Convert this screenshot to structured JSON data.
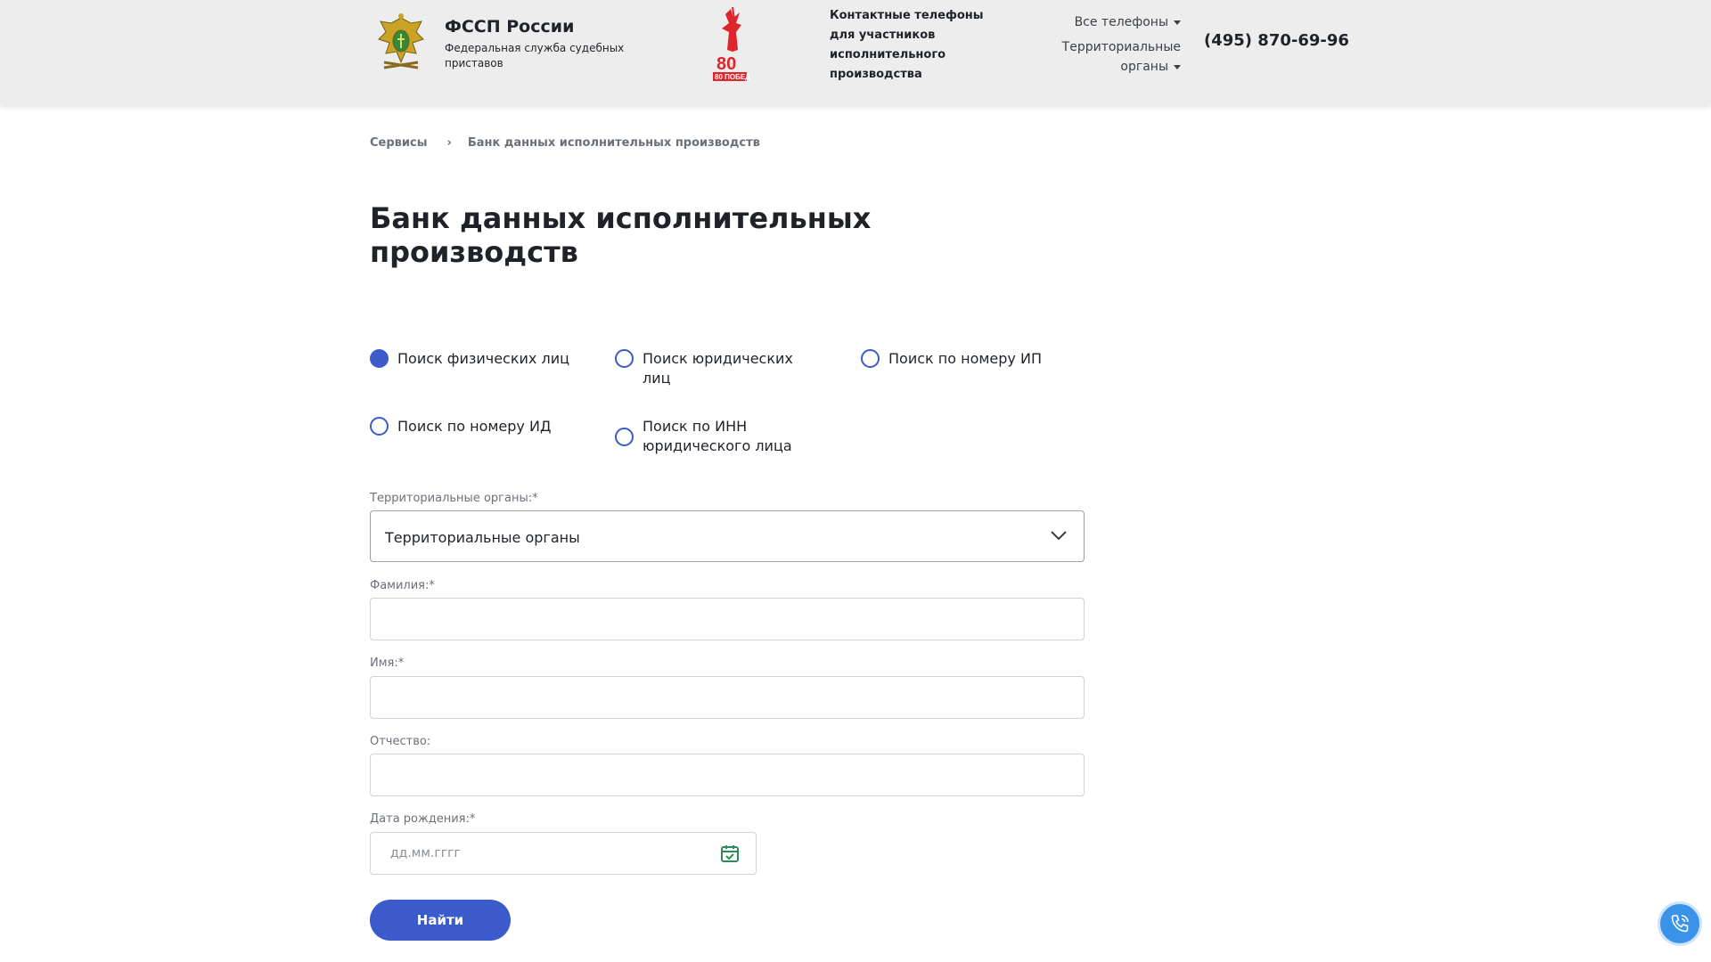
{
  "header": {
    "brand_title": "ФССП России",
    "brand_subtitle": "Федеральная служба судебных приставов",
    "victory_badge": "80 ПОБЕДА!",
    "contacts_text": "Контактные телефоны для участников исполнительного производства",
    "all_phones": "Все телефоны",
    "territorial": "Территориальные органы",
    "phone": "(495) 870-69-96"
  },
  "breadcrumb": {
    "items": [
      "Сервисы",
      "Банк данных исполнительных производств"
    ],
    "separator": "›"
  },
  "page_title": "Банк данных исполнительных производств",
  "search_types": [
    {
      "label": "Поиск физических лиц",
      "checked": true
    },
    {
      "label": "Поиск юридических лиц",
      "checked": false
    },
    {
      "label": "Поиск по номеру ИП",
      "checked": false
    },
    {
      "label": "Поиск по номеру ИД",
      "checked": false
    },
    {
      "label": "Поиск по ИНН юридического лица",
      "checked": false
    }
  ],
  "form": {
    "territorial_label": "Территориальные органы:*",
    "territorial_value": "Территориальные органы",
    "lastname_label": "Фамилия:*",
    "firstname_label": "Имя:*",
    "patronymic_label": "Отчество:",
    "birthdate_label": "Дата рождения:*",
    "birthdate_placeholder": "дд.мм.гггг",
    "submit_label": "Найти"
  },
  "colors": {
    "accent": "#3b5bcc",
    "header_bg": "#ededed",
    "call_button": "#3a93e8"
  },
  "icons": [
    "emblem-icon",
    "victory-icon",
    "chevron-down-icon",
    "calendar-icon",
    "phone-call-icon"
  ]
}
